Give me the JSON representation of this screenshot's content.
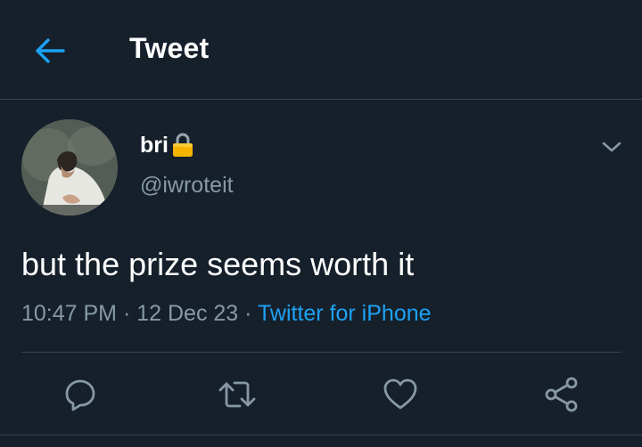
{
  "header": {
    "title": "Tweet",
    "back_icon": "arrow-left-icon",
    "accent_color": "#1da1f2"
  },
  "tweet": {
    "author": {
      "display_name": "bri",
      "handle": "@iwroteit",
      "protected_icon": "lock-icon"
    },
    "text": "but the prize seems worth it",
    "time": "10:47 PM",
    "date": "12 Dec 23",
    "separator": "·",
    "source": "Twitter for iPhone"
  },
  "actions": {
    "reply_icon": "reply-icon",
    "retweet_icon": "retweet-icon",
    "like_icon": "heart-icon",
    "share_icon": "share-icon"
  },
  "theme": {
    "background": "#15202b",
    "secondary_text": "#8899a6",
    "divider": "#38444d"
  }
}
